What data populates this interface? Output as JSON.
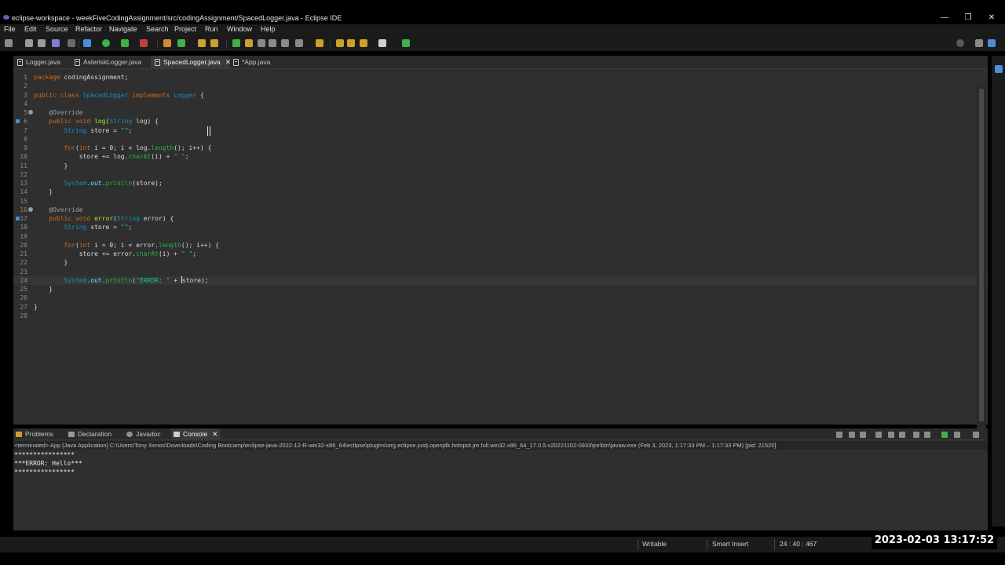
{
  "window": {
    "title": "eclipse-workspace - weekFiveCodingAssignment/src/codingAssignment/SpacedLogger.java - Eclipse IDE",
    "controls": {
      "minimize": "—",
      "restore": "❐",
      "close": "✕"
    }
  },
  "menu": [
    "File",
    "Edit",
    "Source",
    "Refactor",
    "Navigate",
    "Search",
    "Project",
    "Run",
    "Window",
    "Help"
  ],
  "editor": {
    "tabs": [
      {
        "label": "Logger.java",
        "active": false
      },
      {
        "label": "AsteriskLogger.java",
        "active": false
      },
      {
        "label": "SpacedLogger.java",
        "active": true,
        "close": "✕"
      },
      {
        "label": "*App.java",
        "active": false
      }
    ],
    "lines": [
      {
        "n": "1",
        "html": "<span class=\"kw\">package</span> codingAssignment;"
      },
      {
        "n": "2",
        "html": ""
      },
      {
        "n": "3",
        "html": "<span class=\"kw\">public class</span> <span class=\"ty\">SpacedLogger</span> <span class=\"kw\">implements</span> <span class=\"ty\">Logger</span> {"
      },
      {
        "n": "4",
        "html": ""
      },
      {
        "n": "5",
        "html": "    <span class=\"an\">@Override</span>",
        "fold": true
      },
      {
        "n": "6",
        "html": "    <span class=\"kw\">public void</span> <span class=\"fn\">log</span>(<span class=\"ty\">String</span> log) {",
        "marker": true
      },
      {
        "n": "7",
        "html": "        <span class=\"ty\">String</span> store = <span class=\"st\">\"\"</span>;"
      },
      {
        "n": "8",
        "html": ""
      },
      {
        "n": "9",
        "html": "        <span class=\"kw\">for</span>(<span class=\"kw\">int</span> i = 0; i &lt; log.<span class=\"mt\">length</span>(); i++) {"
      },
      {
        "n": "10",
        "html": "            store += log.<span class=\"mt\">charAt</span>(i) + <span class=\"st\">\" \"</span>;"
      },
      {
        "n": "11",
        "html": "        }"
      },
      {
        "n": "12",
        "html": ""
      },
      {
        "n": "13",
        "html": "        <span class=\"ty\">System</span>.<span class=\"fd\">out</span>.<span class=\"mt\">println</span>(store);"
      },
      {
        "n": "14",
        "html": "    }"
      },
      {
        "n": "15",
        "html": ""
      },
      {
        "n": "16",
        "html": "    <span class=\"an\">@Override</span>",
        "fold": true
      },
      {
        "n": "17",
        "html": "    <span class=\"kw\">public void</span> <span class=\"fn\">error</span>(<span class=\"ty\">String</span> error) {",
        "marker": true
      },
      {
        "n": "18",
        "html": "        <span class=\"ty\">String</span> store = <span class=\"st\">\"\"</span>;"
      },
      {
        "n": "19",
        "html": ""
      },
      {
        "n": "20",
        "html": "        <span class=\"kw\">for</span>(<span class=\"kw\">int</span> i = 0; i &lt; error.<span class=\"mt\">length</span>(); i++) {"
      },
      {
        "n": "21",
        "html": "            store += error.<span class=\"mt\">charAt</span>(i) + <span class=\"st\">\" \"</span>;"
      },
      {
        "n": "22",
        "html": "        }"
      },
      {
        "n": "23",
        "html": ""
      },
      {
        "n": "24",
        "html": "        <span class=\"ty\">System</span>.<span class=\"fd\">out</span>.<span class=\"mt\">println</span>(<span class=\"st\">\"ERROR: \"</span> + <span class=\"cursor\"></span>store);",
        "current": true
      },
      {
        "n": "25",
        "html": "    }"
      },
      {
        "n": "26",
        "html": ""
      },
      {
        "n": "27",
        "html": "}"
      },
      {
        "n": "28",
        "html": ""
      }
    ]
  },
  "panel": {
    "tabs": [
      {
        "label": "Problems",
        "icon": "problems-icon",
        "color": "#c9a227",
        "active": false
      },
      {
        "label": "Declaration",
        "icon": "declaration-icon",
        "color": "#9a9a9a",
        "active": false
      },
      {
        "label": "Javadoc",
        "icon": "javadoc-icon",
        "color": "#8f8f8f",
        "active": false
      },
      {
        "label": "Console",
        "icon": "console-icon",
        "color": "#d0d0d0",
        "active": true,
        "close": "✕"
      }
    ],
    "console_description": "<terminated> App [Java Application] C:\\Users\\Tony Xenos\\Downloads\\Coding Bootcamp\\eclipse-java-2022-12-R-win32-x86_64\\eclipse\\plugins\\org.eclipse.justj.openjdk.hotspot.jre.full.win32.x86_64_17.0.5.v20221102-0933\\jre\\bin\\javaw.exe  (Feb 3, 2023, 1:17:33 PM – 1:17:33 PM) [pid: 21520]",
    "console_output": [
      "****************",
      "***ERROR: Hello***",
      "****************"
    ]
  },
  "status": {
    "writable": "Writable",
    "insert_mode": "Smart Insert",
    "position": "24 : 40 : 467"
  },
  "overlay_timestamp": "2023-02-03  13:17:52"
}
